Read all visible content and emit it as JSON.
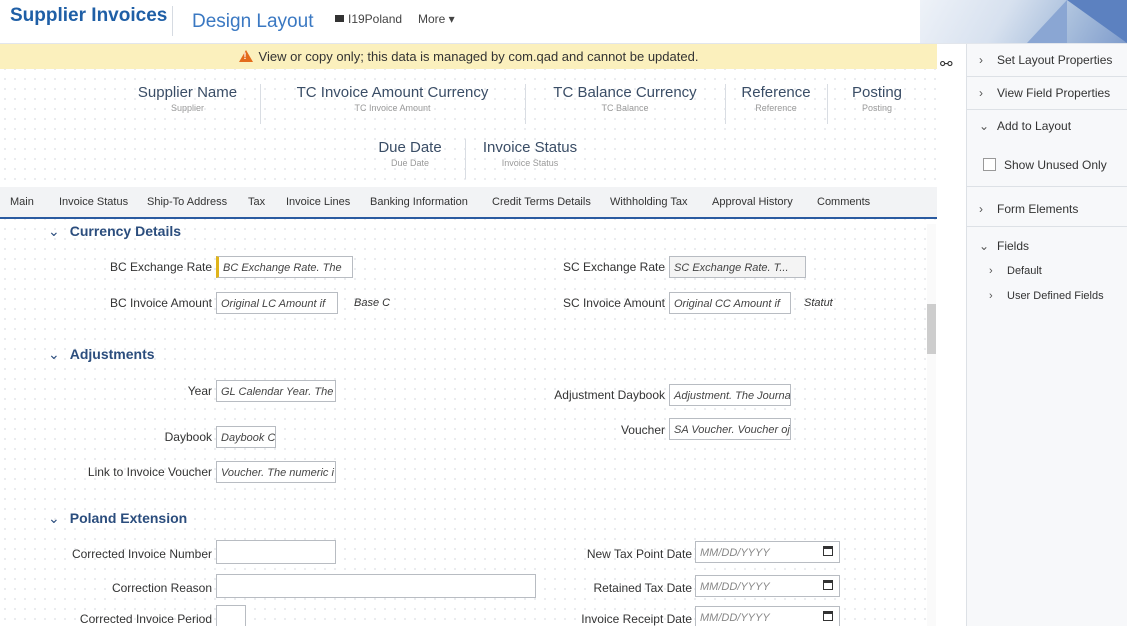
{
  "header": {
    "title": "Supplier Invoices",
    "subtitle": "Design Layout",
    "entity": "I19Poland",
    "more": "More ▾"
  },
  "banner": {
    "text": "View or copy only; this data is managed by com.qad and cannot be updated."
  },
  "header_fields": [
    {
      "label": "Supplier  Name",
      "sub": "Supplier"
    },
    {
      "label": "TC Invoice Amount  Currency",
      "sub": "TC Invoice Amount"
    },
    {
      "label": "TC Balance  Currency",
      "sub": "TC Balance"
    },
    {
      "label": "Reference",
      "sub": "Reference"
    },
    {
      "label": "Posting",
      "sub": "Posting"
    },
    {
      "label": "Due Date",
      "sub": "Due Date"
    },
    {
      "label": "Invoice Status",
      "sub": "Invoice Status"
    }
  ],
  "tabs": [
    "Main",
    "Invoice Status",
    "Ship-To Address",
    "Tax",
    "Invoice Lines",
    "Banking Information",
    "Credit Terms Details",
    "Withholding Tax",
    "Approval History",
    "Comments"
  ],
  "sections": {
    "currency": {
      "title": "Currency Details",
      "bc_rate": {
        "label": "BC Exchange Rate",
        "value": "BC Exchange Rate. The"
      },
      "sc_rate": {
        "label": "SC Exchange Rate",
        "value": "SC Exchange Rate. T..."
      },
      "bc_amount": {
        "label": "BC Invoice Amount",
        "value": "Original LC Amount if ",
        "after": "Base C"
      },
      "sc_amount": {
        "label": "SC Invoice Amount",
        "value": "Original CC Amount if",
        "after": "Statut"
      }
    },
    "adjustments": {
      "title": "Adjustments",
      "year": {
        "label": "Year",
        "value": "GL Calendar Year. The"
      },
      "adj_daybook": {
        "label": "Adjustment Daybook",
        "value": "Adjustment. The Journa"
      },
      "daybook": {
        "label": "Daybook",
        "value": "Daybook C"
      },
      "voucher": {
        "label": "Voucher",
        "value": "SA Voucher. Voucher oj"
      },
      "link_voucher": {
        "label": "Link to Invoice Voucher",
        "value": "Voucher. The numeric i"
      }
    },
    "poland": {
      "title": "Poland Extension",
      "corrected_number": {
        "label": "Corrected Invoice Number",
        "value": ""
      },
      "new_tax_date": {
        "label": "New Tax Point Date",
        "placeholder": "MM/DD/YYYY"
      },
      "correction_reason": {
        "label": "Correction Reason",
        "value": ""
      },
      "retained_tax_date": {
        "label": "Retained Tax Date",
        "placeholder": "MM/DD/YYYY"
      },
      "corrected_period": {
        "label": "Corrected Invoice Period",
        "value": ""
      },
      "receipt_date": {
        "label": "Invoice Receipt Date",
        "placeholder": "MM/DD/YYYY"
      }
    }
  },
  "right_panel": {
    "set_layout": "Set Layout Properties",
    "view_field": "View Field Properties",
    "add_to_layout": "Add to Layout",
    "show_unused": "Show Unused Only",
    "form_elements": "Form Elements",
    "fields": "Fields",
    "default": "Default",
    "user_defined": "User Defined Fields"
  }
}
